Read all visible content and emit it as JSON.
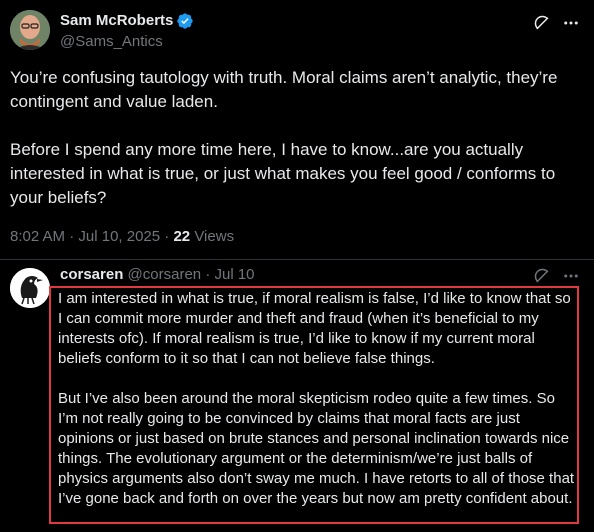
{
  "main_tweet": {
    "author_name": "Sam McRoberts",
    "handle": "@Sams_Antics",
    "paragraphs": [
      "You’re confusing tautology with truth. Moral claims aren’t analytic, they’re contingent and value laden.",
      "Before I spend any more time here, I have to know...are you actually interested in what is true, or just what makes you feel good / conforms to your beliefs?"
    ],
    "time": "8:02 AM",
    "separator": "·",
    "date": "Jul 10, 2025",
    "views_count": "22",
    "views_label": "Views"
  },
  "reply": {
    "author_name": "corsaren",
    "handle": "@corsaren",
    "separator": "·",
    "date": "Jul 10",
    "paragraphs": [
      "I am interested in what is true, if moral realism is false, I’d like to know that so I can commit more murder and theft and fraud (when it’s beneficial to my interests ofc). If moral realism is true, I’d like to know if my current moral beliefs conform to it so that I can not believe false things.",
      "But I’ve also been around the moral skepticism rodeo quite a few times. So I’m not really going to be convinced by claims that moral facts are just opinions or just based on brute stances and personal inclination towards nice things. The evolutionary argument or the determinism/we’re just balls of physics arguments also don’t sway me much. I have retorts to all of those that I’ve gone back and forth on over the years but now am pretty confident about."
    ]
  },
  "icons": {
    "verified": "verified-badge-icon",
    "grok": "grok-icon",
    "more": "more-options-icon"
  },
  "colors": {
    "background": "#000000",
    "text_primary": "#e7e9ea",
    "text_secondary": "#71767b",
    "verified_blue": "#1d9bf0",
    "highlight_border": "#e0393e",
    "divider": "#2f3336"
  }
}
